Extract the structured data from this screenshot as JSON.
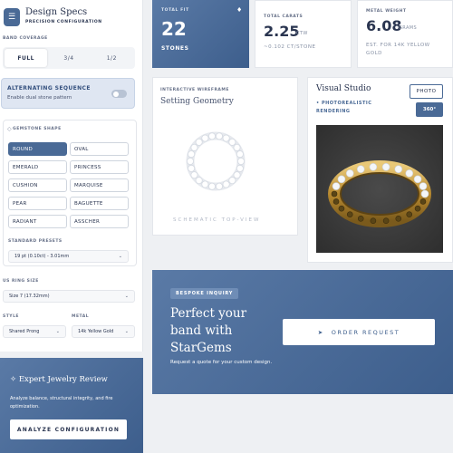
{
  "brand": {
    "title": "Design Specs",
    "subtitle": "PRECISION CONFIGURATION",
    "icon": "sliders-icon"
  },
  "band_coverage": {
    "label": "BAND COVERAGE",
    "options": [
      "FULL",
      "3/4",
      "1/2"
    ],
    "selected": "FULL"
  },
  "alternating": {
    "title": "ALTERNATING SEQUENCE",
    "subtitle": "Enable dual stone pattern",
    "enabled": false
  },
  "gemstone": {
    "label": "GEMSTONE SHAPE",
    "shapes": [
      "ROUND",
      "OVAL",
      "EMERALD",
      "PRINCESS",
      "CUSHION",
      "MARQUISE",
      "PEAR",
      "BAGUETTE",
      "RADIANT",
      "ASSCHER"
    ],
    "selected": "ROUND",
    "presets_label": "STANDARD PRESETS",
    "preset_value": "19 pt (0.10ct) - 3.01mm"
  },
  "ring_size": {
    "label": "US RING SIZE",
    "value": "Size 7 (17.32mm)"
  },
  "style": {
    "label": "STYLE",
    "value": "Shared Prong"
  },
  "metal": {
    "label": "METAL",
    "value": "14k Yellow Gold"
  },
  "stats": {
    "fit": {
      "label": "TOTAL FIT",
      "value": "22",
      "unit": "STONES"
    },
    "carats": {
      "label": "TOTAL CARATS",
      "value": "2.25",
      "unit": "CTW",
      "note": "~0.102 CT/STONE"
    },
    "weight": {
      "label": "METAL WEIGHT",
      "value": "6.08",
      "unit": "GRAMS",
      "note": "EST. FOR 14K YELLOW GOLD"
    }
  },
  "wireframe": {
    "label": "INTERACTIVE WIREFRAME",
    "title": "Setting Geometry",
    "caption": "SCHEMATIC TOP-VIEW",
    "stone_count": 22
  },
  "visual_studio": {
    "title": "Visual Studio",
    "subtitle": "PHOTOREALISTIC RENDERING",
    "photo_button": "PHOTO",
    "view_button": "360°"
  },
  "inquiry": {
    "badge": "BESPOKE INQUIRY",
    "title": "Perfect your band with StarGems",
    "text": "Request a quote for your custom design.",
    "button": "ORDER REQUEST"
  },
  "expert": {
    "title": "Expert Jewelry Review",
    "text": "Analyze balance, structural integrity, and fire optimization.",
    "button": "ANALYZE CONFIGURATION"
  },
  "colors": {
    "accent": "#4a6a96",
    "accent_dark": "#3d5e8c",
    "text": "#2a3550",
    "gold": "#c9a34a"
  }
}
